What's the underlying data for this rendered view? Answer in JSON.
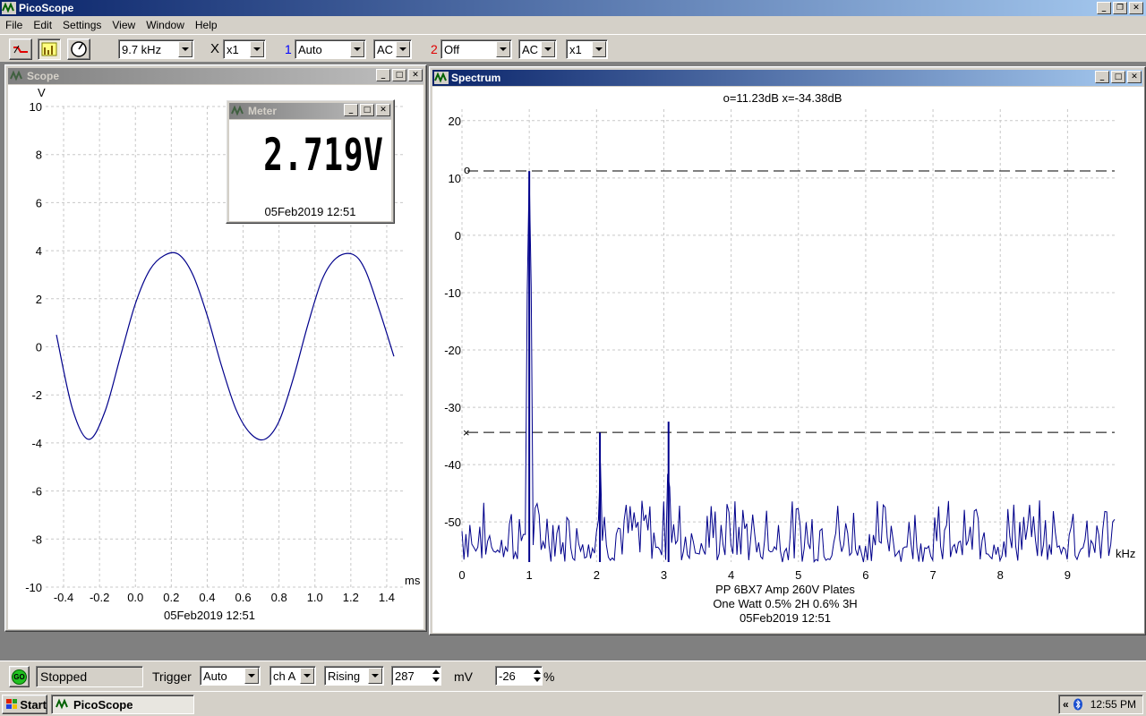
{
  "app": {
    "title": "PicoScope",
    "menu": [
      "File",
      "Edit",
      "Settings",
      "View",
      "Window",
      "Help"
    ]
  },
  "toolbar": {
    "timebase": "9.7 kHz",
    "x_mult_label": "X",
    "x_mult": "x1",
    "ch1_label": "1",
    "ch1_range": "Auto",
    "ch1_coupling": "AC",
    "ch2_label": "2",
    "ch2_range": "Off",
    "ch2_coupling": "AC",
    "ch2_mult": "x1"
  },
  "scope_window": {
    "title": "Scope",
    "y_unit": "V",
    "x_unit": "ms",
    "y_ticks": [
      "10",
      "8",
      "6",
      "4",
      "2",
      "0",
      "-2",
      "-4",
      "-6",
      "-8",
      "-10"
    ],
    "x_ticks": [
      "-0.4",
      "-0.2",
      "0.0",
      "0.2",
      "0.4",
      "0.6",
      "0.8",
      "1.0",
      "1.2",
      "1.4"
    ],
    "footer": "05Feb2019  12:51"
  },
  "meter_window": {
    "title": "Meter",
    "reading": "2.719V",
    "footer": "05Feb2019  12:51"
  },
  "spectrum_window": {
    "title": "Spectrum",
    "marker_readout": "o=11.23dB  x=-34.38dB",
    "y_ticks": [
      "20",
      "10",
      "0",
      "-10",
      "-20",
      "-30",
      "-40",
      "-50"
    ],
    "x_ticks": [
      "0",
      "1",
      "2",
      "3",
      "4",
      "5",
      "6",
      "7",
      "8",
      "9"
    ],
    "x_unit": "kHz",
    "marker_o": "o",
    "marker_x": "×",
    "notes": [
      "PP 6BX7  Amp 260V Plates",
      "One Watt 0.5% 2H 0.6% 3H",
      "05Feb2019  12:51"
    ]
  },
  "statusbar": {
    "go_label": "GO",
    "state": "Stopped",
    "trigger_label": "Trigger",
    "trigger_mode": "Auto",
    "trigger_channel": "ch A",
    "trigger_edge": "Rising",
    "trigger_level": "287",
    "level_unit": "mV",
    "pretrigger": "-26",
    "pretrigger_unit": "%"
  },
  "taskbar": {
    "start_label": "Start",
    "task_label": "PicoScope",
    "tray_chevron": "«",
    "clock": "12:55 PM"
  },
  "colors": {
    "trace": "#00008b",
    "title_active": "#0a246a",
    "title_inactive": "#808080",
    "ch1": "#0000ff",
    "ch2": "#ff0000"
  },
  "chart_data": [
    {
      "type": "line",
      "name": "scope",
      "xlabel": "ms",
      "ylabel": "V",
      "xlim": [
        -0.5,
        1.5
      ],
      "ylim": [
        -10,
        10
      ],
      "grid": true,
      "series": [
        {
          "x": [
            -0.44,
            -0.35,
            -0.26,
            -0.17,
            -0.08,
            0.0,
            0.08,
            0.16,
            0.24,
            0.32,
            0.4,
            0.48,
            0.56,
            0.64,
            0.72,
            0.8,
            0.88,
            0.96,
            1.04,
            1.12,
            1.21,
            1.28,
            1.36,
            1.44
          ],
          "y": [
            0.5,
            -2.6,
            -3.85,
            -2.7,
            -0.3,
            1.8,
            3.2,
            3.8,
            3.85,
            3.0,
            1.3,
            -0.8,
            -2.6,
            -3.6,
            -3.85,
            -3.1,
            -1.3,
            0.9,
            2.8,
            3.7,
            3.85,
            3.2,
            1.5,
            -0.4
          ]
        }
      ]
    },
    {
      "type": "line",
      "name": "spectrum",
      "xlabel": "kHz",
      "ylabel": "",
      "xlim": [
        0,
        9.7
      ],
      "ylim": [
        -57,
        22
      ],
      "grid": true,
      "markers": {
        "o": 11.23,
        "x": -34.38
      },
      "peaks": [
        {
          "x": 1.0,
          "y": 11.2
        },
        {
          "x": 2.05,
          "y": -34.4
        },
        {
          "x": 3.07,
          "y": -32.5
        }
      ],
      "noise_floor": [
        -57,
        -46
      ]
    }
  ]
}
